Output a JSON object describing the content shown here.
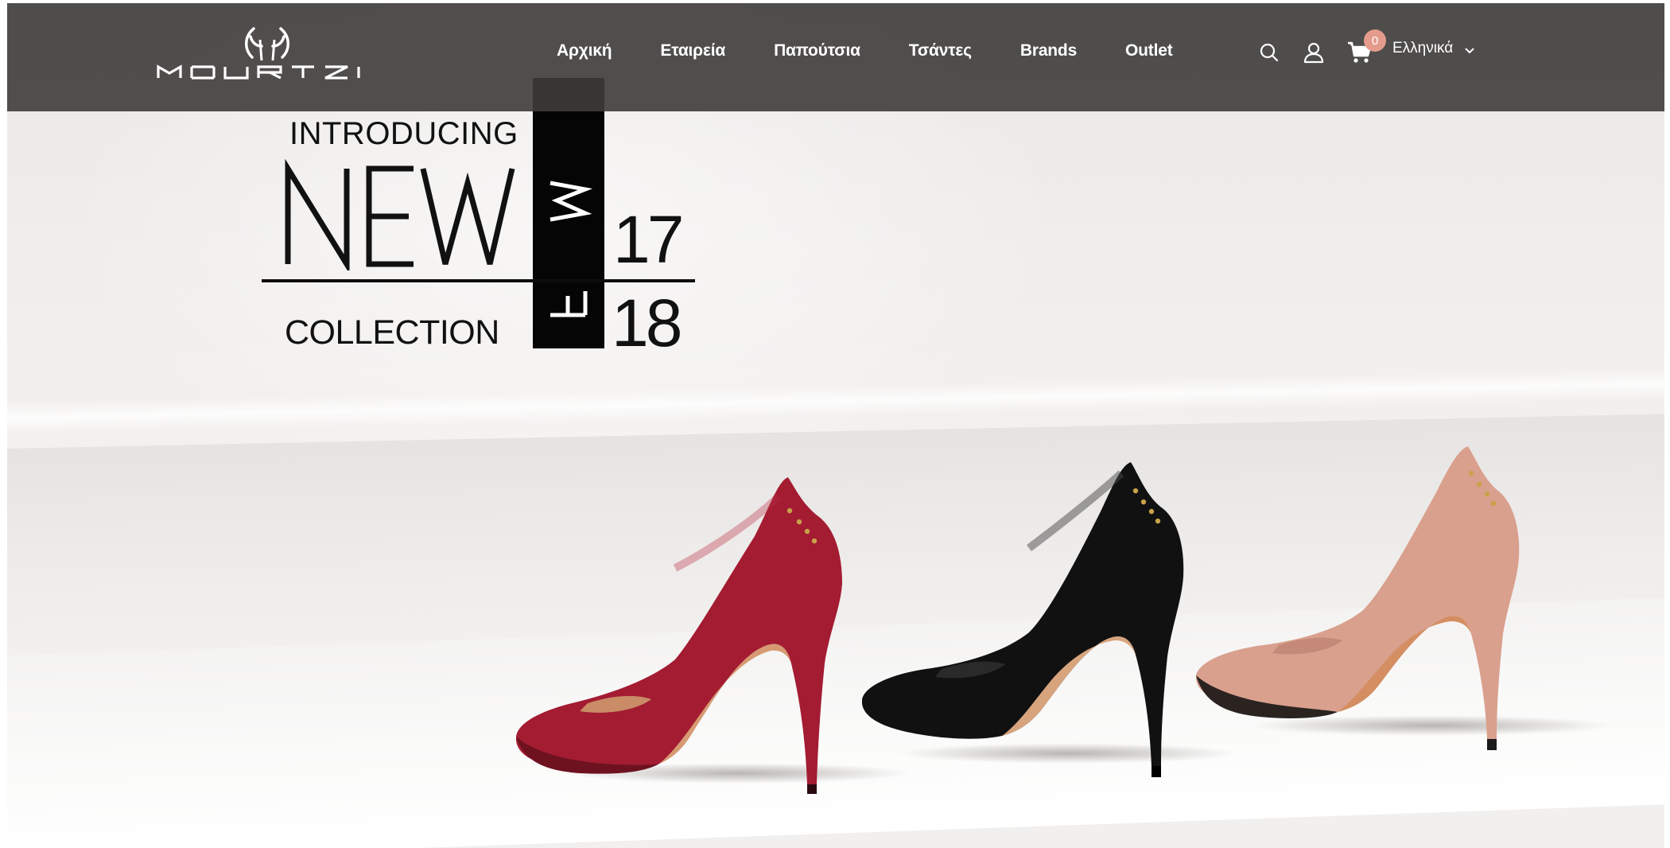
{
  "header": {
    "logo_text": "MOURTZI",
    "nav": [
      {
        "label": "Αρχική"
      },
      {
        "label": "Εταιρεία"
      },
      {
        "label": "Παπούτσια"
      },
      {
        "label": "Τσάντες"
      },
      {
        "label": "Brands"
      },
      {
        "label": "Outlet"
      }
    ],
    "cart_count": "0",
    "language": "Ελληνικά"
  },
  "hero": {
    "intro": "INTRODUCING",
    "headline": "NEW",
    "subline": "COLLECTION",
    "season_letters": "FW",
    "year_top": "17",
    "year_bottom": "18",
    "shoes": [
      {
        "color_name": "red suede",
        "color": "#a31c32"
      },
      {
        "color_name": "black leather",
        "color": "#111111"
      },
      {
        "color_name": "nude suede",
        "color": "#d9a08d"
      }
    ]
  },
  "colors": {
    "header_bg": "#3e3c3b",
    "badge": "#e59b8c",
    "text_dark": "#111111"
  }
}
